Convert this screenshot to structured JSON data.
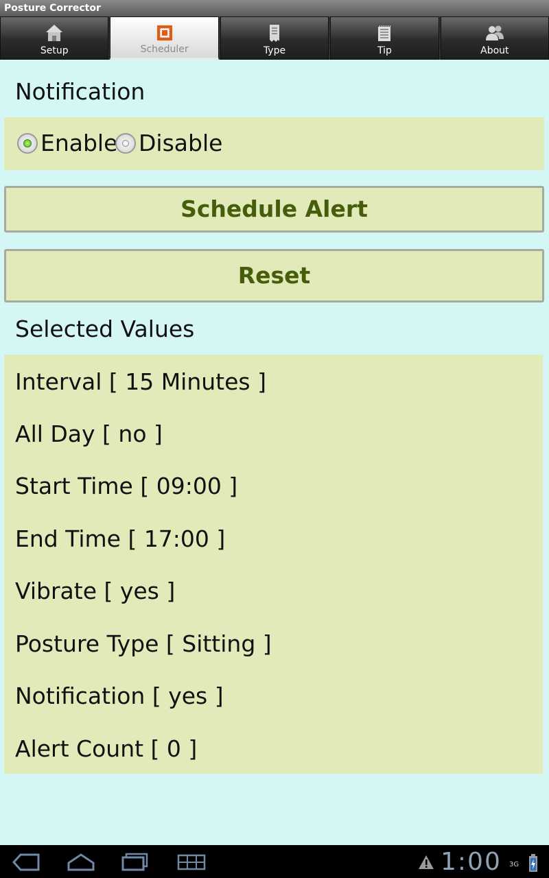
{
  "app": {
    "title": "Posture Corrector"
  },
  "tabs": [
    {
      "label": "Setup",
      "icon": "home-icon"
    },
    {
      "label": "Scheduler",
      "icon": "scheduler-icon",
      "active": true
    },
    {
      "label": "Type",
      "icon": "type-icon"
    },
    {
      "label": "Tip",
      "icon": "notepad-icon"
    },
    {
      "label": "About",
      "icon": "people-icon"
    }
  ],
  "notification": {
    "heading": "Notification",
    "options": [
      {
        "label": "Enable",
        "selected": true
      },
      {
        "label": "Disable",
        "selected": false
      }
    ]
  },
  "buttons": {
    "schedule": "Schedule Alert",
    "reset": "Reset"
  },
  "selected_values": {
    "heading": "Selected Values",
    "items": [
      "Interval [ 15 Minutes ]",
      "All Day [ no ]",
      "Start Time [ 09:00 ]",
      "End Time [ 17:00 ]",
      "Vibrate [ yes ]",
      "Posture Type [ Sitting ]",
      "Notification [ yes ]",
      "Alert Count [ 0 ]"
    ]
  },
  "system_bar": {
    "time": "1:00",
    "network": "3G",
    "icons": [
      "back-icon",
      "home-icon",
      "recent-apps-icon",
      "grid-icon",
      "warning-icon",
      "battery-icon"
    ]
  },
  "colors": {
    "background": "#d4f6f5",
    "panel": "#e3eab9",
    "button_text": "#465e0c",
    "radio_on": "#4db31d"
  }
}
